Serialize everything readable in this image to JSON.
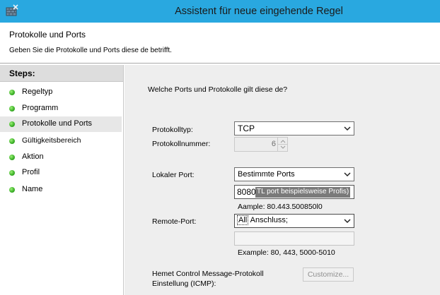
{
  "window": {
    "title": "Assistent für neue eingehende Regel"
  },
  "header": {
    "title": "Protokolle und Ports",
    "description": "Geben Sie die Protokolle und Ports diese de betrifft."
  },
  "sidebar": {
    "heading": "Steps:",
    "items": [
      {
        "label": "Regeltyp",
        "active": false
      },
      {
        "label": "Programm",
        "active": false
      },
      {
        "label": "Protokolle und Ports",
        "active": true
      },
      {
        "label": "Gültigkeitsbereich",
        "active": false
      },
      {
        "label": "Aktion",
        "active": false
      },
      {
        "label": "Profil",
        "active": false
      },
      {
        "label": "Name",
        "active": false
      }
    ]
  },
  "main": {
    "question": "Welche Ports und Protokolle gilt diese de?",
    "protocol_type": {
      "label": "Protokolltyp:",
      "value": "TCP"
    },
    "protocol_number": {
      "label": "Protokollnummer:",
      "value": "6"
    },
    "local_port": {
      "label": "Lokaler Port:",
      "value": "Bestimmte Ports",
      "input_typed": "8080",
      "input_selected": "TL port beispielsweise Profis)",
      "example": "Aample: 80.443.500850l0"
    },
    "remote_port": {
      "label": "Remote-Port:",
      "value_first": "All",
      "value_rest": " Anschluss;",
      "input_value": "",
      "example": "Example: 80, 443, 5000-5010"
    },
    "icmp": {
      "label_line1": "Hemet Control Message-Protokoll",
      "label_line2": "Einstellung (ICMP):",
      "button": "Customize..."
    }
  },
  "colors": {
    "titlebar": "#29a8e0",
    "main_bg": "#eeeeee",
    "status_dot": "#3fb42a"
  }
}
